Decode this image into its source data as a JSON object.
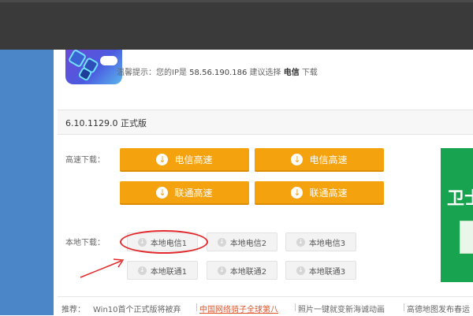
{
  "header": {
    "tip_prefix": "温馨提示：您的IP是",
    "ip": "58.56.190.186",
    "tip_middle": "建议选择",
    "isp": "电信",
    "tip_suffix": "下载"
  },
  "version": "6.10.1129.0 正式版",
  "fast_download": {
    "label": "高速下载：",
    "buttons": [
      "电信高速",
      "电信高速",
      "联通高速",
      "联通高速"
    ]
  },
  "local_download": {
    "label": "本地下载：",
    "buttons": [
      "本地电信1",
      "本地电信2",
      "本地电信3",
      "本地联通1",
      "本地联通2",
      "本地联通3"
    ]
  },
  "ad": {
    "text": "卫士"
  },
  "recommend": {
    "label": "推荐：",
    "items": [
      "Win10首个正式版将被弃",
      "中国网络骑子全球第八",
      "照片一键就变新海诚动画",
      "高德地图发布春运"
    ]
  },
  "colors": {
    "accent_orange": "#f5a20f",
    "highlight_red": "#e2282a",
    "sidebar_blue": "#4a86c8"
  }
}
